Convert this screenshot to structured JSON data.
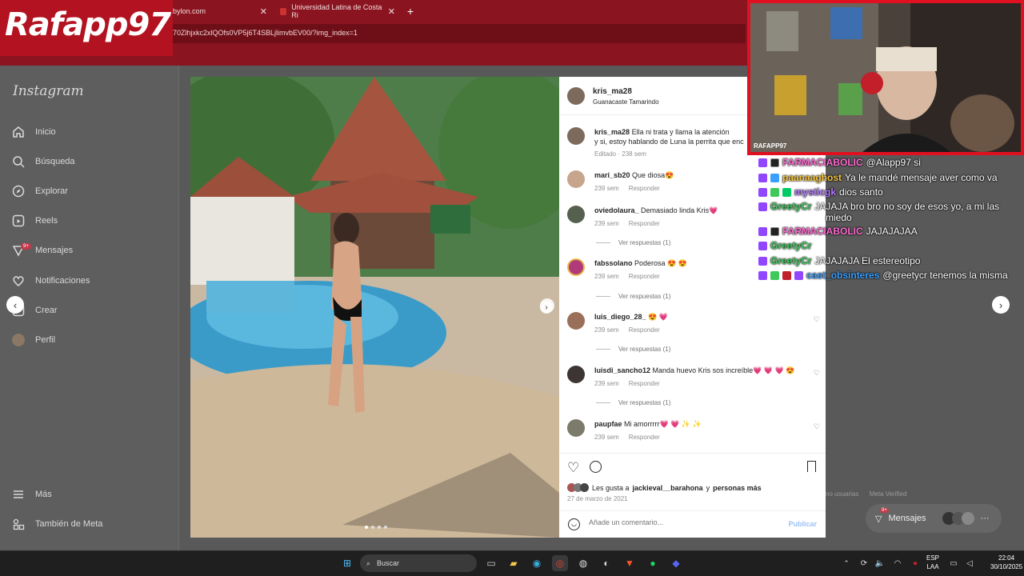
{
  "browser": {
    "tabs": [
      {
        "label": "bylon.com"
      },
      {
        "label": "Universidad Latina de Costa Ri"
      }
    ],
    "url": "70Zlhjxkc2xlQOfs0VP5j6T4SBLjlimvbEV00/?img_index=1"
  },
  "stream": {
    "logo": "Rafapp97",
    "cam_label": "RAFAPP97",
    "chat": [
      {
        "user": "FARMACIABOLIC",
        "color": "#ff6bd0",
        "message": "@Alapp97 si"
      },
      {
        "user": "paanaaghost",
        "color": "#f4c542",
        "message": "Ya le mandé mensaje aver como va"
      },
      {
        "user": "mysticgk",
        "color": "#b57cff",
        "message": "dios santo"
      },
      {
        "user": "GreetyCr",
        "color": "#3ec95a",
        "message": "JAJAJA bro bro no soy de esos yo, a mi las"
      },
      {
        "user": "",
        "color": "#3ec95a",
        "message": "miedo"
      },
      {
        "user": "FARMACIABOLIC",
        "color": "#ff6bd0",
        "message": "JAJAJAJAA"
      },
      {
        "user": "GreetyCr",
        "color": "#3ec95a",
        "message": ""
      },
      {
        "user": "GreetyCr",
        "color": "#3ec95a",
        "message": "JAJAJAJA El estereotipo"
      },
      {
        "user": "cast_obsinteres",
        "color": "#3aa0ff",
        "message": "@greetycr tenemos la misma"
      }
    ]
  },
  "sidebar": {
    "brand": "Instagram",
    "items": [
      {
        "label": "Inicio",
        "icon": "home-icon"
      },
      {
        "label": "Búsqueda",
        "icon": "search-icon"
      },
      {
        "label": "Explorar",
        "icon": "compass-icon"
      },
      {
        "label": "Reels",
        "icon": "reels-icon"
      },
      {
        "label": "Mensajes",
        "icon": "messenger-icon"
      },
      {
        "label": "Notificaciones",
        "icon": "heart-icon"
      },
      {
        "label": "Crear",
        "icon": "plus-icon"
      },
      {
        "label": "Perfil",
        "icon": "avatar-icon"
      }
    ],
    "messages_badge": "9+",
    "more": "Más",
    "meta": "También de Meta"
  },
  "post": {
    "username": "kris_ma28",
    "location": "Guanacaste Tamarindo",
    "caption_user": "kris_ma28",
    "caption_line1": "Ella ni trata y llama la atención",
    "caption_line2": "y si, estoy hablando de Luna la perrita que enc",
    "caption_meta": "Editado · 238 sem",
    "comments": [
      {
        "user": "mari_sb20",
        "text": "Que diosa😍",
        "time": "239 sem",
        "reply": "Responder",
        "replies": ""
      },
      {
        "user": "oviedolaura_",
        "text": "Demasiado linda Kris💗",
        "time": "239 sem",
        "reply": "Responder",
        "replies": "Ver respuestas (1)"
      },
      {
        "user": "fabssolano",
        "text": "Poderosa 😍 😍",
        "time": "239 sem",
        "reply": "Responder",
        "replies": "Ver respuestas (1)"
      },
      {
        "user": "luis_diego_28_",
        "text": "😍 💗",
        "time": "239 sem",
        "reply": "Responder",
        "replies": "Ver respuestas (1)"
      },
      {
        "user": "luisdi_sancho12",
        "text": "Manda huevo Kris sos increíble💗 💗 💗 😍",
        "time": "239 sem",
        "reply": "Responder",
        "replies": "Ver respuestas (1)"
      },
      {
        "user": "paupfae",
        "text": "Mi amorrrrr💗 💗 ✨ ✨",
        "time": "239 sem",
        "reply": "Responder",
        "replies": ""
      }
    ],
    "likes_prefix": "Les gusta a",
    "likes_user": "jackieval__barahona",
    "likes_and": "y",
    "likes_more": "personas más",
    "date": "27 de marzo de 2021",
    "add_comment_placeholder": "Añade un comentario...",
    "publish": "Publicar"
  },
  "right": {
    "footer_a": "no usuarias",
    "footer_b": "Meta Verified",
    "messages_label": "Mensajes",
    "messages_badge": "9+"
  },
  "taskbar": {
    "search": "Buscar",
    "lang1": "ESP",
    "lang2": "LAA",
    "time": "22:04",
    "date": "30/10/2025"
  },
  "colors": {
    "chrome": "#8a1420",
    "logo_bg": "#b31220",
    "cam_border": "#e01020",
    "link_blue": "#9ec1f3"
  }
}
